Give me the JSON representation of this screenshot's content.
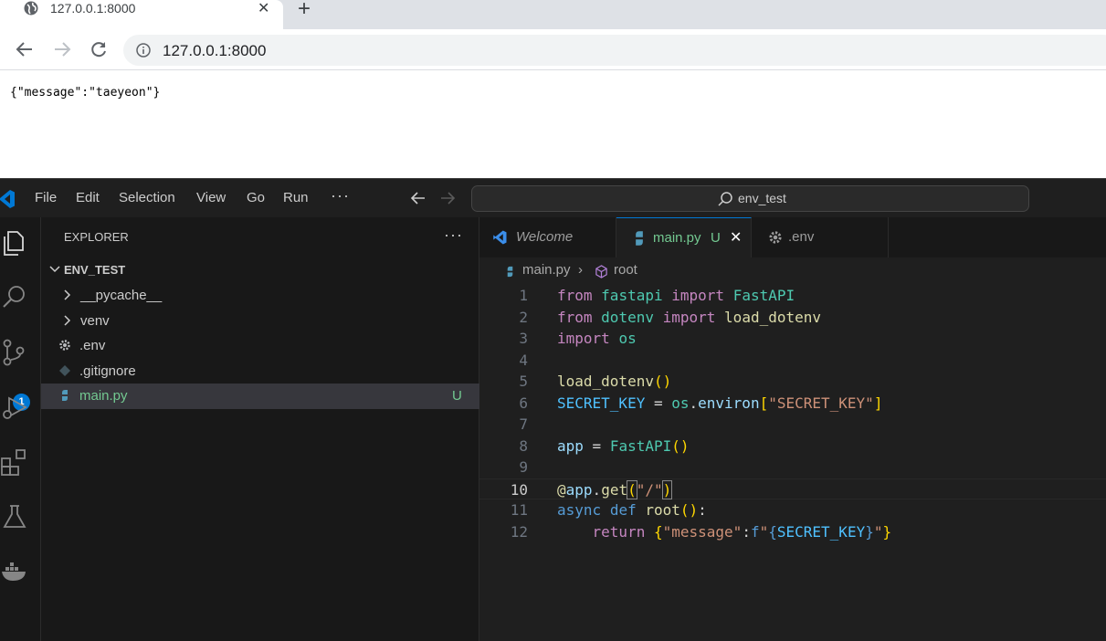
{
  "browser": {
    "tab_title": "127.0.0.1:8000",
    "url": "127.0.0.1:8000",
    "page_body": "{\"message\":\"taeyeon\"}"
  },
  "vscode": {
    "menu": [
      "File",
      "Edit",
      "Selection",
      "View",
      "Go",
      "Run"
    ],
    "search_text": "env_test",
    "source_control_badge": "1",
    "explorer": {
      "title": "EXPLORER",
      "root": "ENV_TEST",
      "items": [
        {
          "label": "__pycache__",
          "kind": "folder"
        },
        {
          "label": "venv",
          "kind": "folder"
        },
        {
          "label": ".env",
          "kind": "settings"
        },
        {
          "label": ".gitignore",
          "kind": "git"
        },
        {
          "label": "main.py",
          "kind": "python",
          "status": "U"
        }
      ]
    },
    "tabs": [
      {
        "label": "Welcome"
      },
      {
        "label": "main.py",
        "status": "U"
      },
      {
        "label": ".env"
      }
    ],
    "breadcrumb": {
      "file": "main.py",
      "symbol": "root"
    },
    "line_numbers": [
      "1",
      "2",
      "3",
      "4",
      "5",
      "6",
      "7",
      "8",
      "9",
      "10",
      "11",
      "12"
    ],
    "current_line": "10",
    "colors": {
      "accent": "#0078d4",
      "untracked": "#73c991",
      "python_icon": "#519aba"
    }
  }
}
